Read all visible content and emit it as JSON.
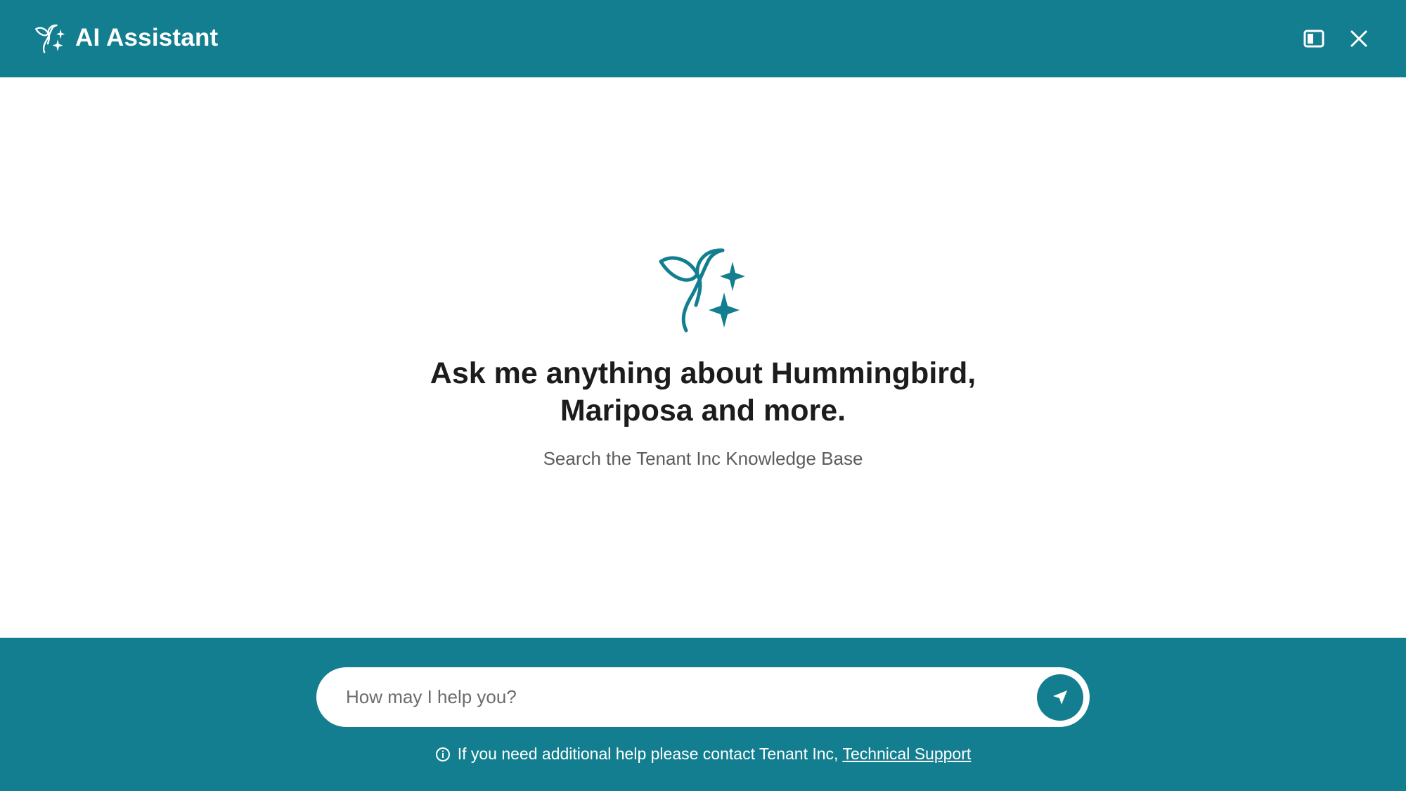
{
  "header": {
    "title": "AI Assistant",
    "panel_icon": "side-panel-icon",
    "close_icon": "close-icon"
  },
  "hero": {
    "heading_line1": "Ask me anything about Hummingbird,",
    "heading_line2": "Mariposa and more.",
    "subtitle": "Search the Tenant Inc Knowledge Base"
  },
  "footer": {
    "input_placeholder": "How may I help you?",
    "input_value": "",
    "send_icon": "send-icon",
    "help_text": "If you need additional help please contact Tenant Inc,",
    "help_link": "Technical Support"
  },
  "colors": {
    "brand": "#137e8f",
    "heading": "#1c1c1c",
    "subtitle": "#5c5c5c"
  }
}
